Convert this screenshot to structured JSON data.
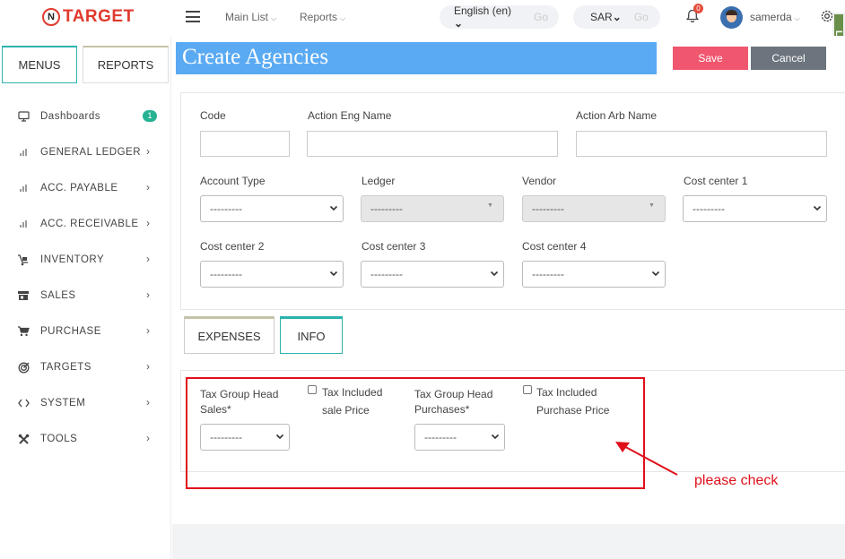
{
  "brand": {
    "mark": "N",
    "name": "TARGET",
    "color": "#e03a2e"
  },
  "topnav": {
    "main_list": "Main List",
    "reports": "Reports",
    "language": "English (en)",
    "language_go": "Go",
    "currency": "SAR",
    "currency_go": "Go",
    "notifications_count": "0",
    "username": "samerda",
    "side_tab_text": "Lab"
  },
  "sidebar": {
    "tabs": {
      "menus": "MENUS",
      "reports": "REPORTS"
    },
    "items": [
      {
        "label": "Dashboards",
        "icon": "monitor-icon",
        "count": "1"
      },
      {
        "label": "GENERAL LEDGER",
        "icon": "bar-chart-icon"
      },
      {
        "label": "ACC. PAYABLE",
        "icon": "bar-chart-icon"
      },
      {
        "label": "ACC. RECEIVABLE",
        "icon": "bar-chart-icon"
      },
      {
        "label": "INVENTORY",
        "icon": "dolly-icon"
      },
      {
        "label": "SALES",
        "icon": "store-icon"
      },
      {
        "label": "PURCHASE",
        "icon": "cart-icon"
      },
      {
        "label": "TARGETS",
        "icon": "target-icon"
      },
      {
        "label": "SYSTEM",
        "icon": "code-icon"
      },
      {
        "label": "TOOLS",
        "icon": "tools-icon"
      }
    ]
  },
  "page": {
    "title": "Create Agencies",
    "save_label": "Save",
    "cancel_label": "Cancel"
  },
  "form": {
    "code_label": "Code",
    "code_value": "",
    "eng_name_label": "Action Eng Name",
    "eng_name_value": "",
    "arb_name_label": "Action Arb Name",
    "arb_name_value": "",
    "account_type_label": "Account Type",
    "ledger_label": "Ledger",
    "vendor_label": "Vendor",
    "cost_center_1_label": "Cost center 1",
    "cost_center_2_label": "Cost center 2",
    "cost_center_3_label": "Cost center 3",
    "cost_center_4_label": "Cost center 4",
    "empty_option": "---------"
  },
  "tabs": {
    "expenses": "EXPENSES",
    "info": "INFO"
  },
  "info": {
    "tax_head_sales_line1": "Tax Group Head",
    "tax_head_sales_line2": "Sales*",
    "tax_incl_sale_line1": "Tax Included",
    "tax_incl_sale_line2": "sale Price",
    "tax_head_purch_line1": "Tax Group Head",
    "tax_head_purch_line2": "Purchases*",
    "tax_incl_purch_line1": "Tax Included",
    "tax_incl_purch_line2": "Purchase Price",
    "empty_option": "---------"
  },
  "annotation": {
    "note": "please check",
    "color": "#e0101a"
  },
  "colors": {
    "accent": "#5aaaf3",
    "save": "#f0566d",
    "cancel": "#6c757d",
    "teal": "#2bb3ae"
  }
}
